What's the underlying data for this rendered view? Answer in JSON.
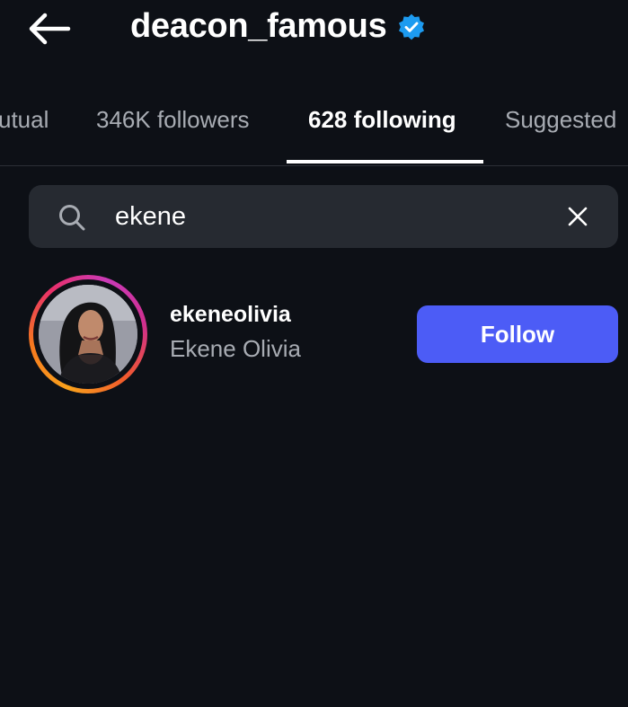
{
  "header": {
    "title": "deacon_famous",
    "verified": true
  },
  "tabs": [
    {
      "label": "utual",
      "active": false
    },
    {
      "label": "346K followers",
      "active": false
    },
    {
      "label": "628 following",
      "active": true
    },
    {
      "label": "Suggested",
      "active": false
    }
  ],
  "search": {
    "value": "ekene"
  },
  "results": [
    {
      "username": "ekeneolivia",
      "full_name": "Ekene Olivia",
      "action_label": "Follow"
    }
  ],
  "colors": {
    "background": "#0d1016",
    "accent": "#4c5cf6",
    "verified_badge": "#1d9bf0",
    "secondary_text": "#a8acb3"
  },
  "icons": [
    "back-arrow-icon",
    "verified-badge-icon",
    "search-icon",
    "clear-icon"
  ]
}
